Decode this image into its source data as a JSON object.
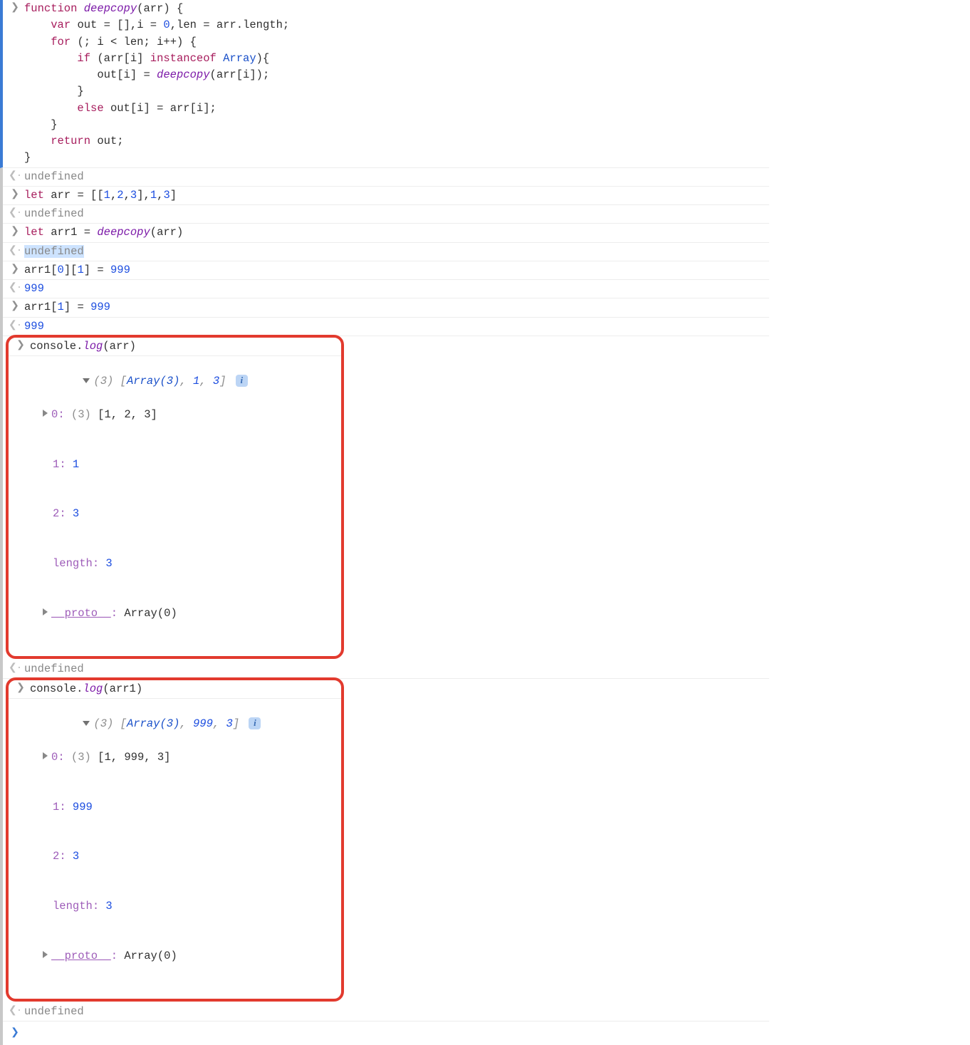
{
  "entries": {
    "e0_code": "function deepcopy(arr) {\n    var out = [],i = 0,len = arr.length;\n    for (; i < len; i++) {\n        if (arr[i] instanceof Array){\n           out[i] = deepcopy(arr[i]);\n        }\n        else out[i] = arr[i];\n    }\n    return out;\n}",
    "e0_tokens": [
      {
        "t": "function ",
        "c": "kw"
      },
      {
        "t": "deepcopy",
        "c": "fn"
      },
      {
        "t": "(",
        "c": "punct"
      },
      {
        "t": "arr",
        "c": "op"
      },
      {
        "t": ") {\n",
        "c": "punct"
      },
      {
        "t": "    ",
        "c": ""
      },
      {
        "t": "var ",
        "c": "kw"
      },
      {
        "t": "out ",
        "c": "op"
      },
      {
        "t": "= ",
        "c": "op"
      },
      {
        "t": "[]",
        "c": "punct"
      },
      {
        "t": ",",
        "c": "punct"
      },
      {
        "t": "i ",
        "c": "op"
      },
      {
        "t": "= ",
        "c": "op"
      },
      {
        "t": "0",
        "c": "num"
      },
      {
        "t": ",",
        "c": "punct"
      },
      {
        "t": "len ",
        "c": "op"
      },
      {
        "t": "= ",
        "c": "op"
      },
      {
        "t": "arr",
        "c": "op"
      },
      {
        "t": ".",
        "c": "punct"
      },
      {
        "t": "length",
        "c": "op"
      },
      {
        "t": ";\n",
        "c": "punct"
      },
      {
        "t": "    ",
        "c": ""
      },
      {
        "t": "for ",
        "c": "kw"
      },
      {
        "t": "(; ",
        "c": "punct"
      },
      {
        "t": "i ",
        "c": "op"
      },
      {
        "t": "< ",
        "c": "op"
      },
      {
        "t": "len",
        "c": "op"
      },
      {
        "t": "; ",
        "c": "punct"
      },
      {
        "t": "i",
        "c": "op"
      },
      {
        "t": "++",
        "c": "op"
      },
      {
        "t": ") {\n",
        "c": "punct"
      },
      {
        "t": "        ",
        "c": ""
      },
      {
        "t": "if ",
        "c": "kw"
      },
      {
        "t": "(",
        "c": "punct"
      },
      {
        "t": "arr",
        "c": "op"
      },
      {
        "t": "[",
        "c": "punct"
      },
      {
        "t": "i",
        "c": "op"
      },
      {
        "t": "] ",
        "c": "punct"
      },
      {
        "t": "instanceof ",
        "c": "kw"
      },
      {
        "t": "Array",
        "c": "id"
      },
      {
        "t": "){\n",
        "c": "punct"
      },
      {
        "t": "           ",
        "c": ""
      },
      {
        "t": "out",
        "c": "op"
      },
      {
        "t": "[",
        "c": "punct"
      },
      {
        "t": "i",
        "c": "op"
      },
      {
        "t": "] ",
        "c": "punct"
      },
      {
        "t": "= ",
        "c": "op"
      },
      {
        "t": "deepcopy",
        "c": "fn"
      },
      {
        "t": "(",
        "c": "punct"
      },
      {
        "t": "arr",
        "c": "op"
      },
      {
        "t": "[",
        "c": "punct"
      },
      {
        "t": "i",
        "c": "op"
      },
      {
        "t": "]);",
        "c": "punct"
      },
      {
        "t": "\n",
        "c": ""
      },
      {
        "t": "        }\n",
        "c": "punct"
      },
      {
        "t": "        ",
        "c": ""
      },
      {
        "t": "else ",
        "c": "kw"
      },
      {
        "t": "out",
        "c": "op"
      },
      {
        "t": "[",
        "c": "punct"
      },
      {
        "t": "i",
        "c": "op"
      },
      {
        "t": "] ",
        "c": "punct"
      },
      {
        "t": "= ",
        "c": "op"
      },
      {
        "t": "arr",
        "c": "op"
      },
      {
        "t": "[",
        "c": "punct"
      },
      {
        "t": "i",
        "c": "op"
      },
      {
        "t": "];",
        "c": "punct"
      },
      {
        "t": "\n",
        "c": ""
      },
      {
        "t": "    }\n",
        "c": "punct"
      },
      {
        "t": "    ",
        "c": ""
      },
      {
        "t": "return ",
        "c": "kw"
      },
      {
        "t": "out",
        "c": "op"
      },
      {
        "t": ";",
        "c": "punct"
      },
      {
        "t": "\n",
        "c": ""
      },
      {
        "t": "}",
        "c": "punct"
      }
    ],
    "e1_out": "undefined",
    "e2_tokens": [
      {
        "t": "let ",
        "c": "kw"
      },
      {
        "t": "arr ",
        "c": "op"
      },
      {
        "t": "= ",
        "c": "op"
      },
      {
        "t": "[[",
        "c": "punct"
      },
      {
        "t": "1",
        "c": "num"
      },
      {
        "t": ",",
        "c": "punct"
      },
      {
        "t": "2",
        "c": "num"
      },
      {
        "t": ",",
        "c": "punct"
      },
      {
        "t": "3",
        "c": "num"
      },
      {
        "t": "],",
        "c": "punct"
      },
      {
        "t": "1",
        "c": "num"
      },
      {
        "t": ",",
        "c": "punct"
      },
      {
        "t": "3",
        "c": "num"
      },
      {
        "t": "]",
        "c": "punct"
      }
    ],
    "e3_out": "undefined",
    "e4_tokens": [
      {
        "t": "let ",
        "c": "kw"
      },
      {
        "t": "arr1 ",
        "c": "op"
      },
      {
        "t": "= ",
        "c": "op"
      },
      {
        "t": "deepcopy",
        "c": "fn"
      },
      {
        "t": "(",
        "c": "punct"
      },
      {
        "t": "arr",
        "c": "op"
      },
      {
        "t": ")",
        "c": "punct"
      }
    ],
    "e5_out": "undefined",
    "e6_tokens": [
      {
        "t": "arr1",
        "c": "op"
      },
      {
        "t": "[",
        "c": "punct"
      },
      {
        "t": "0",
        "c": "num"
      },
      {
        "t": "][",
        "c": "punct"
      },
      {
        "t": "1",
        "c": "num"
      },
      {
        "t": "] ",
        "c": "punct"
      },
      {
        "t": "= ",
        "c": "op"
      },
      {
        "t": "999",
        "c": "num"
      }
    ],
    "e7_out": "999",
    "e8_tokens": [
      {
        "t": "arr1",
        "c": "op"
      },
      {
        "t": "[",
        "c": "punct"
      },
      {
        "t": "1",
        "c": "num"
      },
      {
        "t": "] ",
        "c": "punct"
      },
      {
        "t": "= ",
        "c": "op"
      },
      {
        "t": "999",
        "c": "num"
      }
    ],
    "e9_out": "999",
    "e10_tokens": [
      {
        "t": "console",
        "c": "op"
      },
      {
        "t": ".",
        "c": "punct"
      },
      {
        "t": "log",
        "c": "fn"
      },
      {
        "t": "(",
        "c": "punct"
      },
      {
        "t": "arr",
        "c": "op"
      },
      {
        "t": ")",
        "c": "punct"
      }
    ],
    "obj_arr": {
      "summary_len": "(3)",
      "summary_inner": "[Array(3), 1, 3]",
      "summary_v1": "1",
      "summary_v2": "3",
      "idx0_key": "0",
      "idx0_len": "(3)",
      "idx0_vals": "[1, 2, 3]",
      "idx1_key": "1",
      "idx1_val": "1",
      "idx2_key": "2",
      "idx2_val": "3",
      "length_key": "length",
      "length_val": "3",
      "proto_key": "__proto__",
      "proto_val": "Array(0)"
    },
    "e11_out": "undefined",
    "e12_tokens": [
      {
        "t": "console",
        "c": "op"
      },
      {
        "t": ".",
        "c": "punct"
      },
      {
        "t": "log",
        "c": "fn"
      },
      {
        "t": "(",
        "c": "punct"
      },
      {
        "t": "arr1",
        "c": "op"
      },
      {
        "t": ")",
        "c": "punct"
      }
    ],
    "obj_arr1": {
      "summary_len": "(3)",
      "summary_v0": "Array(3)",
      "summary_v1": "999",
      "summary_v2": "3",
      "idx0_key": "0",
      "idx0_len": "(3)",
      "idx0_vals": "[1, 999, 3]",
      "idx1_key": "1",
      "idx1_val": "999",
      "idx2_key": "2",
      "idx2_val": "3",
      "length_key": "length",
      "length_val": "3",
      "proto_key": "__proto__",
      "proto_val": "Array(0)"
    },
    "e13_out": "undefined"
  },
  "info_badge_glyph": "i"
}
